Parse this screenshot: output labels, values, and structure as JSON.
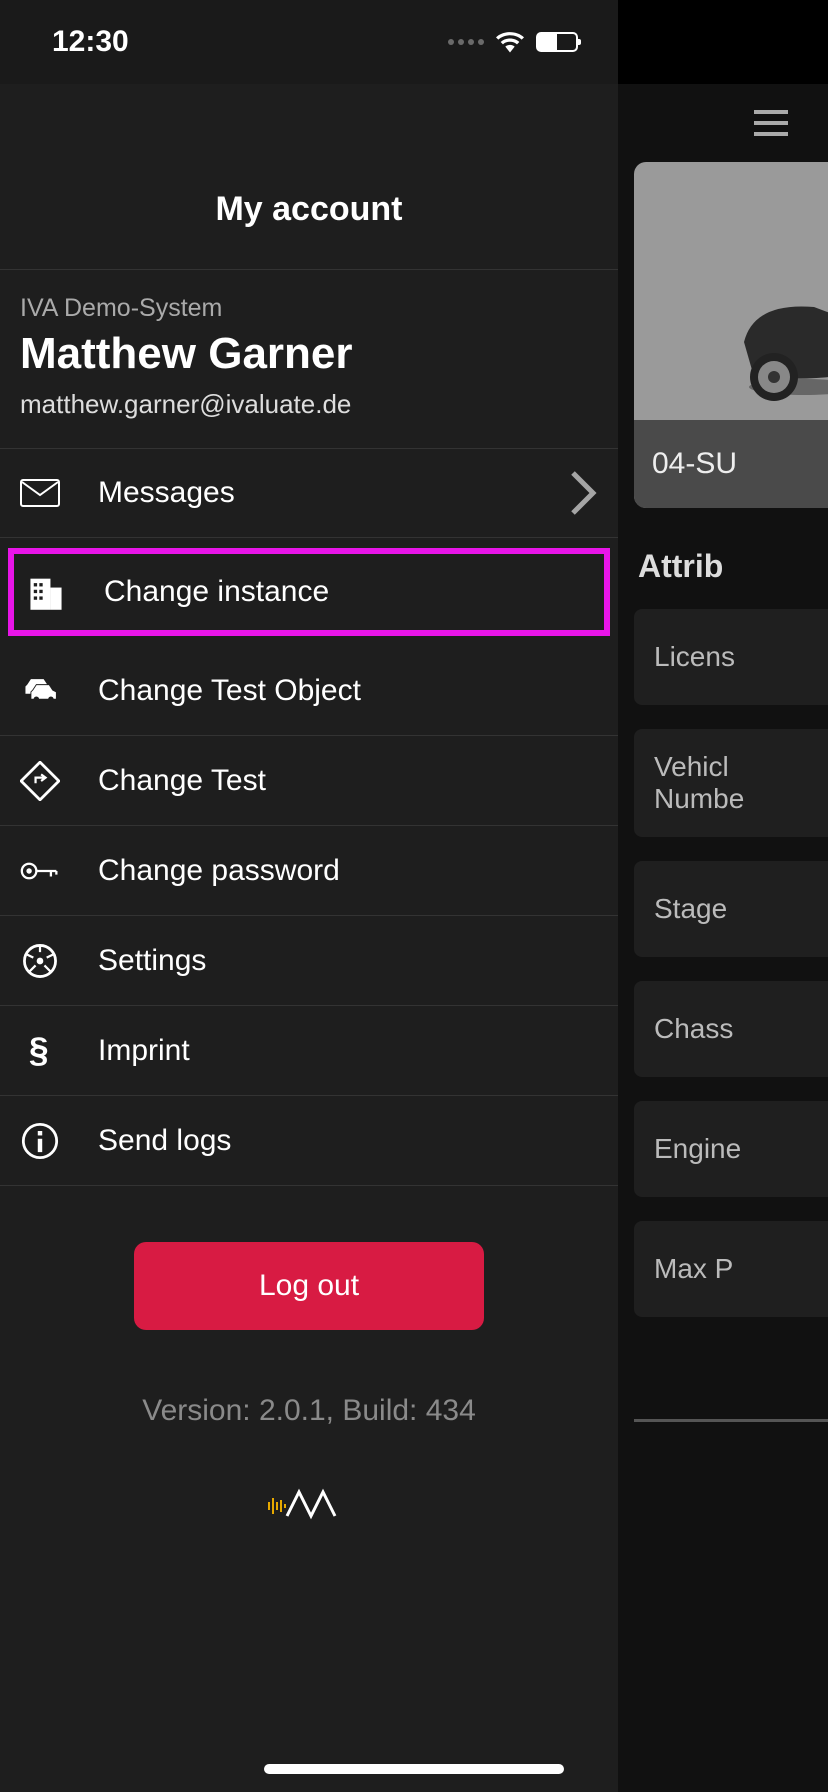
{
  "status": {
    "time": "12:30"
  },
  "drawer": {
    "title": "My account",
    "system": "IVA Demo-System",
    "user_name": "Matthew Garner",
    "user_email": "matthew.garner@ivaluate.de",
    "menu": {
      "messages": "Messages",
      "change_instance": "Change instance",
      "change_test_object": "Change Test Object",
      "change_test": "Change Test",
      "change_password": "Change password",
      "settings": "Settings",
      "imprint": "Imprint",
      "send_logs": "Send logs"
    },
    "logout": "Log out",
    "version": "Version: 2.0.1, Build: 434"
  },
  "background": {
    "card_label": "04-SU",
    "attributes_title": "Attrib",
    "rows": {
      "license": "Licens",
      "vin": "Vehicl\nNumbe",
      "stage": "Stage",
      "chassis": "Chass",
      "engine": "Engine",
      "maxp": "Max P"
    }
  },
  "highlight_color": "#e815e8",
  "accent_color": "#d81b43"
}
